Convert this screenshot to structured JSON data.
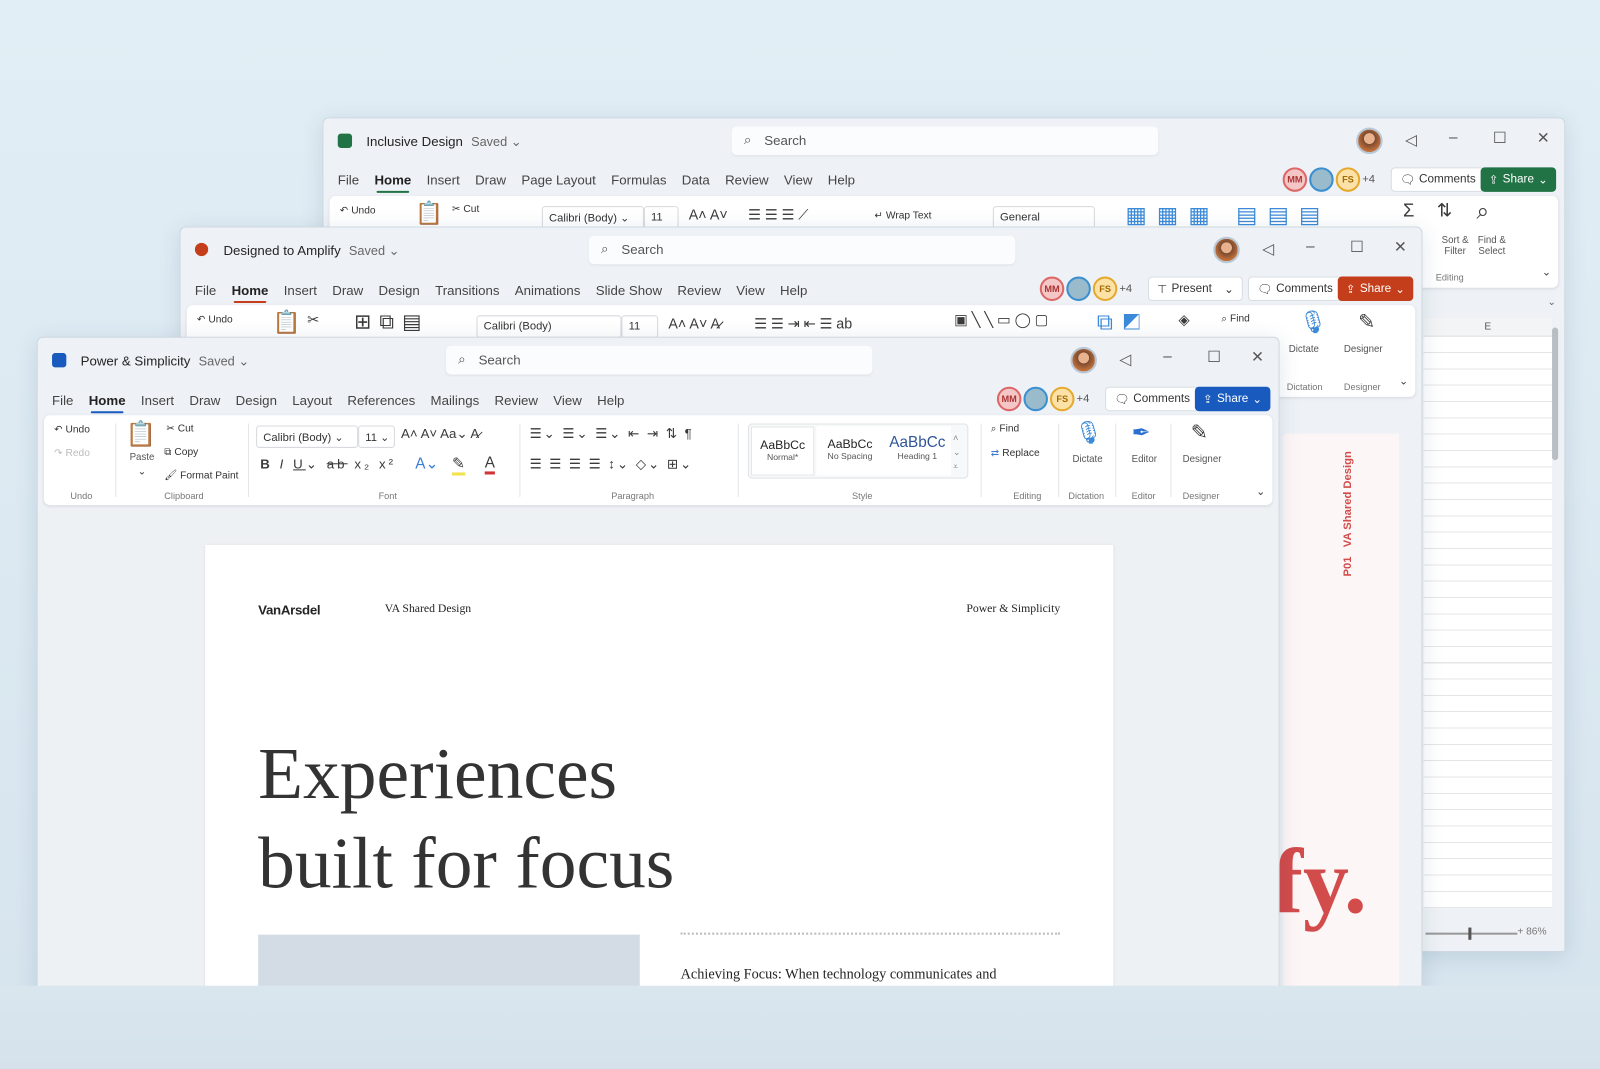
{
  "colors": {
    "excel": "#217346",
    "ppt": "#c43e1c",
    "word": "#185abd",
    "slide_accent": "#d34c4c",
    "background": "#dde9f1"
  },
  "excel": {
    "app_icon": "excel-icon",
    "title": "Inclusive Design",
    "saved": "Saved ⌄",
    "search": "Search",
    "tabs": [
      "File",
      "Home",
      "Insert",
      "Draw",
      "Page Layout",
      "Formulas",
      "Data",
      "Review",
      "View",
      "Help"
    ],
    "presence": [
      "MM",
      "FS"
    ],
    "presence_more": "+4",
    "comments": "Comments",
    "share": "Share",
    "ribbon": {
      "undo": "Undo",
      "cut": "Cut",
      "font": "Calibri (Body)",
      "size": "11",
      "wrap_text": "Wrap Text",
      "number_format": "General",
      "sort_filter": "Sort & Filter",
      "find_select": "Find & Select",
      "editing_group": "Editing"
    },
    "column_header": "E",
    "zoom": "86%"
  },
  "ppt": {
    "app_icon": "powerpoint-icon",
    "title": "Designed to Amplify",
    "saved": "Saved ⌄",
    "search": "Search",
    "tabs": [
      "File",
      "Home",
      "Insert",
      "Draw",
      "Design",
      "Transitions",
      "Animations",
      "Slide Show",
      "Review",
      "View",
      "Help"
    ],
    "presence": [
      "MM",
      "FS"
    ],
    "presence_more": "+4",
    "present": "Present",
    "comments": "Comments",
    "share": "Share",
    "ribbon": {
      "undo": "Undo",
      "font": "Calibri (Body)",
      "size": "11",
      "find": "Find",
      "dictate": "Dictate",
      "designer": "Designer",
      "dictation_group": "Dictation",
      "designer_group": "Designer"
    },
    "slide": {
      "vertical_text": "P01   VA Shared Design",
      "big_text": "fy."
    }
  },
  "word": {
    "app_icon": "word-icon",
    "title": "Power & Simplicity",
    "saved": "Saved ⌄",
    "search": "Search",
    "tabs": [
      "File",
      "Home",
      "Insert",
      "Draw",
      "Design",
      "Layout",
      "References",
      "Mailings",
      "Review",
      "View",
      "Help"
    ],
    "presence": [
      "MM",
      "FS"
    ],
    "presence_more": "+4",
    "comments": "Comments",
    "share": "Share",
    "ribbon": {
      "undo": "Undo",
      "redo": "Redo",
      "paste": "Paste",
      "cut": "Cut",
      "copy": "Copy",
      "format_paint": "Format Paint",
      "font": "Calibri (Body)",
      "size": "11",
      "styles": [
        {
          "sample": "AaBbCc",
          "name": "Normal*"
        },
        {
          "sample": "AaBbCc",
          "name": "No Spacing"
        },
        {
          "sample": "AaBbCc",
          "name": "Heading 1"
        }
      ],
      "find": "Find",
      "replace": "Replace",
      "dictate": "Dictate",
      "editor": "Editor",
      "designer": "Designer",
      "groups": [
        "Undo",
        "Clipboard",
        "Font",
        "Paragraph",
        "Style",
        "Editing",
        "Dictation",
        "Editor",
        "Designer"
      ]
    },
    "doc": {
      "logo": "VanArsdel",
      "header_left": "VA Shared Design",
      "header_right": "Power & Simplicity",
      "headline_1": "Experiences",
      "headline_2": "built for focus",
      "subhead": "Achieving Focus: When technology communicates and"
    }
  }
}
